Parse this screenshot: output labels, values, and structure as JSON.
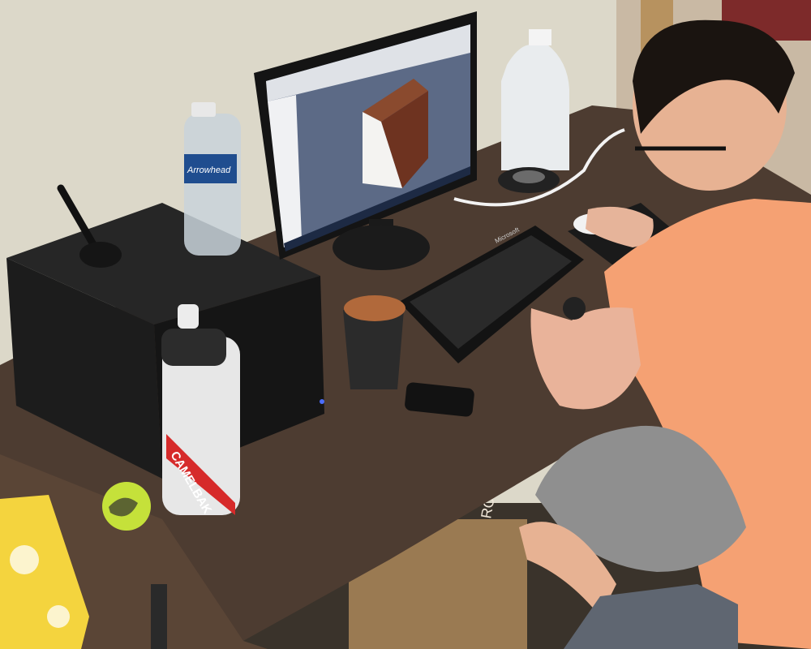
{
  "scene": {
    "colors": {
      "wall": "#dcd8c9",
      "desk": "#4a3a30",
      "desk_edge": "#5b4638",
      "pc_case": "#1f1f1f",
      "monitor": "#141414",
      "screen_bg": "#5d6b86",
      "shirt": "#f6a173",
      "shorts": "#8d8d8d",
      "hair": "#1b1612",
      "skin": "#e8b597",
      "cube_wood": "#7a3b24",
      "tissue_box": "#f4d23d"
    }
  },
  "labels": {
    "water_bottle_brand": "Arrowhead",
    "bottle_brand": "CAMELBAK",
    "box_text": "ROM",
    "keyboard_brand": "Microsoft"
  },
  "icons": {
    "mouse": "mouse-icon",
    "keyboard": "keyboard-icon"
  }
}
